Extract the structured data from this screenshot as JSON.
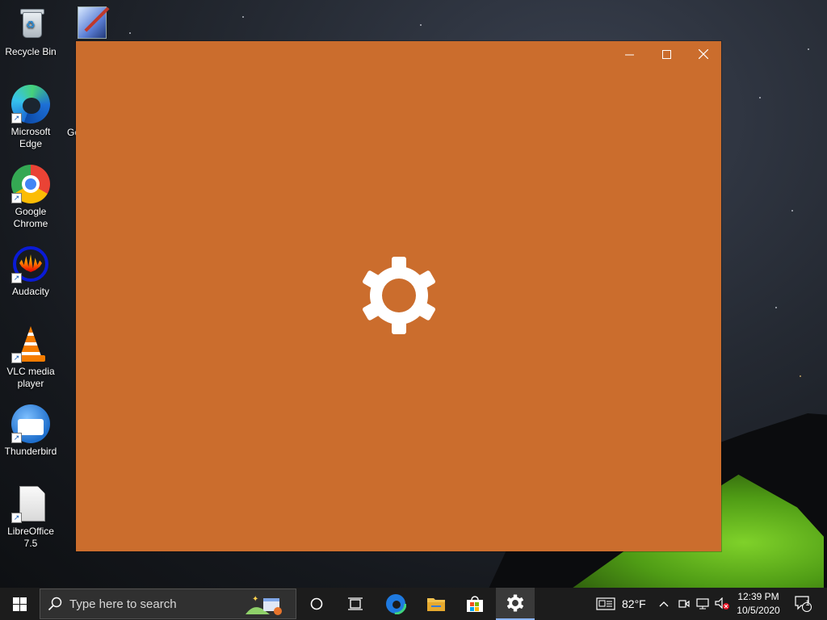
{
  "desktop": {
    "icons": [
      {
        "label": "Recycle Bin"
      },
      {
        "label": "Microsoft Edge"
      },
      {
        "label": "Google Chrome"
      },
      {
        "label": "Audacity"
      },
      {
        "label": "VLC media player"
      },
      {
        "label": "Thunderbird"
      },
      {
        "label": "LibreOffice 7.5"
      }
    ],
    "partial_label": "Go"
  },
  "window": {
    "background_color": "#cb6d2d",
    "splash_icon": "gear-icon",
    "controls": {
      "minimize": "—",
      "maximize": "☐",
      "close": "✕"
    }
  },
  "taskbar": {
    "search_placeholder": "Type here to search",
    "pinned": [
      "task-view",
      "microsoft-edge",
      "file-explorer",
      "microsoft-store",
      "settings"
    ],
    "active": "settings",
    "weather": "82°F",
    "time": "12:39 PM",
    "date": "10/5/2020",
    "notification_count": "1"
  }
}
